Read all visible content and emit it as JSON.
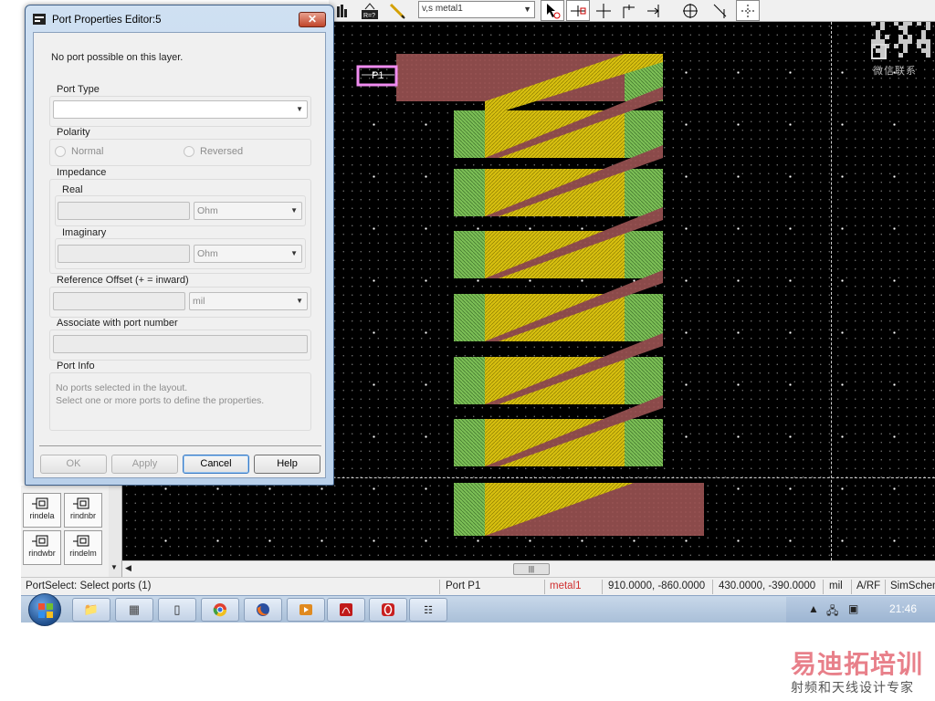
{
  "toolbar": {
    "layer_value": "v,s metal1"
  },
  "dialog": {
    "title": "Port Properties Editor:5",
    "close_glyph": "✕",
    "message": "No port possible on this layer.",
    "port_type": {
      "label": "Port Type",
      "value": ""
    },
    "polarity": {
      "label": "Polarity",
      "normal": "Normal",
      "reversed": "Reversed"
    },
    "impedance": {
      "label": "Impedance",
      "real_label": "Real",
      "real_unit": "Ohm",
      "imaginary_label": "Imaginary",
      "imaginary_unit": "Ohm"
    },
    "reference_offset": {
      "label": "Reference Offset (+ = inward)",
      "unit": "mil"
    },
    "associate": {
      "label": "Associate with port number"
    },
    "port_info": {
      "label": "Port Info",
      "line1": "No ports selected in the layout.",
      "line2": "Select one or more ports to define the properties."
    },
    "buttons": {
      "ok": "OK",
      "apply": "Apply",
      "cancel": "Cancel",
      "help": "Help"
    }
  },
  "canvas": {
    "port_label": "P1",
    "colors": {
      "metal": "#8b4a4a",
      "via": "#d8c010",
      "pad": "#7cbf56",
      "port": "#f08cf0"
    }
  },
  "palette": {
    "items": [
      {
        "label": "rindela"
      },
      {
        "label": "rindnbr"
      },
      {
        "label": "rindwbr"
      },
      {
        "label": "rindelm"
      }
    ]
  },
  "statusbar": {
    "mode": "PortSelect: Select ports (1)",
    "selection": "Port P1",
    "layer": "metal1",
    "coord1": "910.0000, -860.0000",
    "coord2": "430.0000, -390.0000",
    "units": "mil",
    "mode2": "A/RF",
    "sim": "SimSchem"
  },
  "taskbar": {
    "clock": "21:46"
  },
  "watermark": {
    "qr_caption": "微信联系",
    "title": "易迪拓培训",
    "subtitle": "射频和天线设计专家"
  }
}
